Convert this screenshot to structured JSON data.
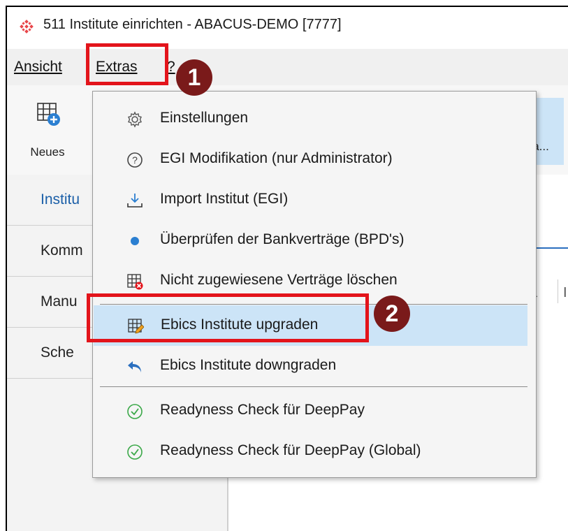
{
  "window": {
    "title": "511 Institute einrichten - ABACUS-DEMO [7777]"
  },
  "menubar": {
    "items": [
      "Ansicht",
      "Extras",
      "?"
    ]
  },
  "ribbon": {
    "new_label": "Neues",
    "right_label": "sta..."
  },
  "sidebar": {
    "items": [
      "Institu",
      "Komm",
      "Manu",
      "Sche"
    ]
  },
  "content": {
    "column_label": "I"
  },
  "annotations": {
    "badge1": "1",
    "badge2": "2"
  },
  "extras_menu": {
    "items": [
      {
        "label": "Einstellungen",
        "icon": "gear-icon"
      },
      {
        "label": "EGI Modifikation (nur Administrator)",
        "icon": "question-circle-icon"
      },
      {
        "label": "Import Institut (EGI)",
        "icon": "download-tray-icon"
      },
      {
        "label": "Überprüfen der Bankverträge (BPD's)",
        "icon": "blue-dot-icon"
      },
      {
        "label": "Nicht zugewiesene Verträge löschen",
        "icon": "grid-delete-icon"
      },
      {
        "label": "Ebics Institute upgraden",
        "icon": "grid-edit-icon"
      },
      {
        "label": "Ebics Institute downgraden",
        "icon": "undo-arrow-icon"
      },
      {
        "label": "Readyness Check für DeepPay",
        "icon": "check-circle-icon"
      },
      {
        "label": "Readyness Check für DeepPay (Global)",
        "icon": "check-circle-icon"
      }
    ]
  },
  "colors": {
    "annotation_red": "#e3141b",
    "badge_dark_red": "#7a1a1a",
    "highlight_blue": "#cce4f7",
    "accent_blue": "#1b5fa8"
  }
}
